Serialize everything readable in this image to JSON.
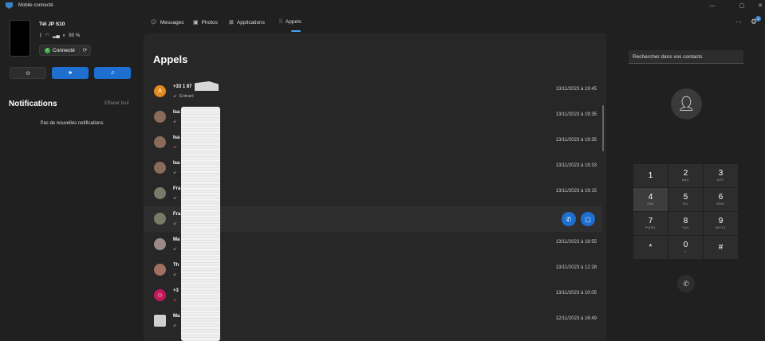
{
  "window": {
    "title": "Mobile connecté",
    "controls": [
      "—",
      "▢",
      "✕"
    ]
  },
  "device": {
    "name": "Tél JP S10",
    "battery": "80 %",
    "status_label": "Connecté"
  },
  "notifications": {
    "title": "Notifications",
    "clear_label": "Effacer tout",
    "empty_text": "Pas de nouvelles notifications"
  },
  "tabs": [
    {
      "label": "Messages",
      "icon": "message-icon"
    },
    {
      "label": "Photos",
      "icon": "photo-icon"
    },
    {
      "label": "Applications",
      "icon": "apps-icon"
    },
    {
      "label": "Appels",
      "icon": "keypad-icon",
      "active": true
    }
  ],
  "settings_badge": "2",
  "calls": {
    "title": "Appels",
    "rows": [
      {
        "name": "+33 1 87",
        "type": "Entrant",
        "date": "13/11/2023 à 19:45",
        "avatar_color": "#e58a1f",
        "avatar_kind": "initial",
        "missed": false
      },
      {
        "name": "Isa",
        "type": "",
        "date": "13/11/2023 à 19:35",
        "avatar_color": "#8a6a5a",
        "avatar_kind": "photo",
        "missed": false
      },
      {
        "name": "Isa",
        "type": "",
        "date": "13/11/2023 à 19:35",
        "avatar_color": "#8a6a5a",
        "avatar_kind": "photo",
        "missed": true
      },
      {
        "name": "Isa",
        "type": "",
        "date": "13/11/2023 à 19:33",
        "avatar_color": "#8a6a5a",
        "avatar_kind": "photo",
        "missed": false
      },
      {
        "name": "Fra",
        "type": "",
        "date": "13/11/2023 à 19:15",
        "avatar_color": "#7a7a6a",
        "avatar_kind": "photo",
        "missed": false
      },
      {
        "name": "Fra",
        "type": "",
        "date": "",
        "avatar_color": "#7a7a6a",
        "avatar_kind": "photo",
        "missed": false,
        "selected": true
      },
      {
        "name": "Ma",
        "type": "",
        "date": "13/11/2023 à 18:55",
        "avatar_color": "#9a8a8a",
        "avatar_kind": "photo",
        "missed": false
      },
      {
        "name": "Th",
        "type": "",
        "date": "13/11/2023 à 12:28",
        "avatar_color": "#a07060",
        "avatar_kind": "photo",
        "missed": false
      },
      {
        "name": "+3",
        "type": "",
        "date": "13/11/2023 à 10:05",
        "avatar_color": "#c2185b",
        "avatar_kind": "person",
        "missed": true
      },
      {
        "name": "Ma",
        "type": "",
        "date": "12/11/2023 à 16:49",
        "avatar_color": "#d0d0d0",
        "avatar_kind": "photo",
        "missed": false
      }
    ]
  },
  "dialer": {
    "search_placeholder": "Rechercher dans vos contacts",
    "keys": [
      {
        "digit": "1",
        "letters": ""
      },
      {
        "digit": "2",
        "letters": "ABC"
      },
      {
        "digit": "3",
        "letters": "DEF"
      },
      {
        "digit": "4",
        "letters": "GHI"
      },
      {
        "digit": "5",
        "letters": "JKL"
      },
      {
        "digit": "6",
        "letters": "MNO"
      },
      {
        "digit": "7",
        "letters": "PQRS"
      },
      {
        "digit": "8",
        "letters": "TUV"
      },
      {
        "digit": "9",
        "letters": "WXYZ"
      },
      {
        "digit": "*",
        "letters": ""
      },
      {
        "digit": "0",
        "letters": "+"
      },
      {
        "digit": "#",
        "letters": ""
      }
    ]
  }
}
